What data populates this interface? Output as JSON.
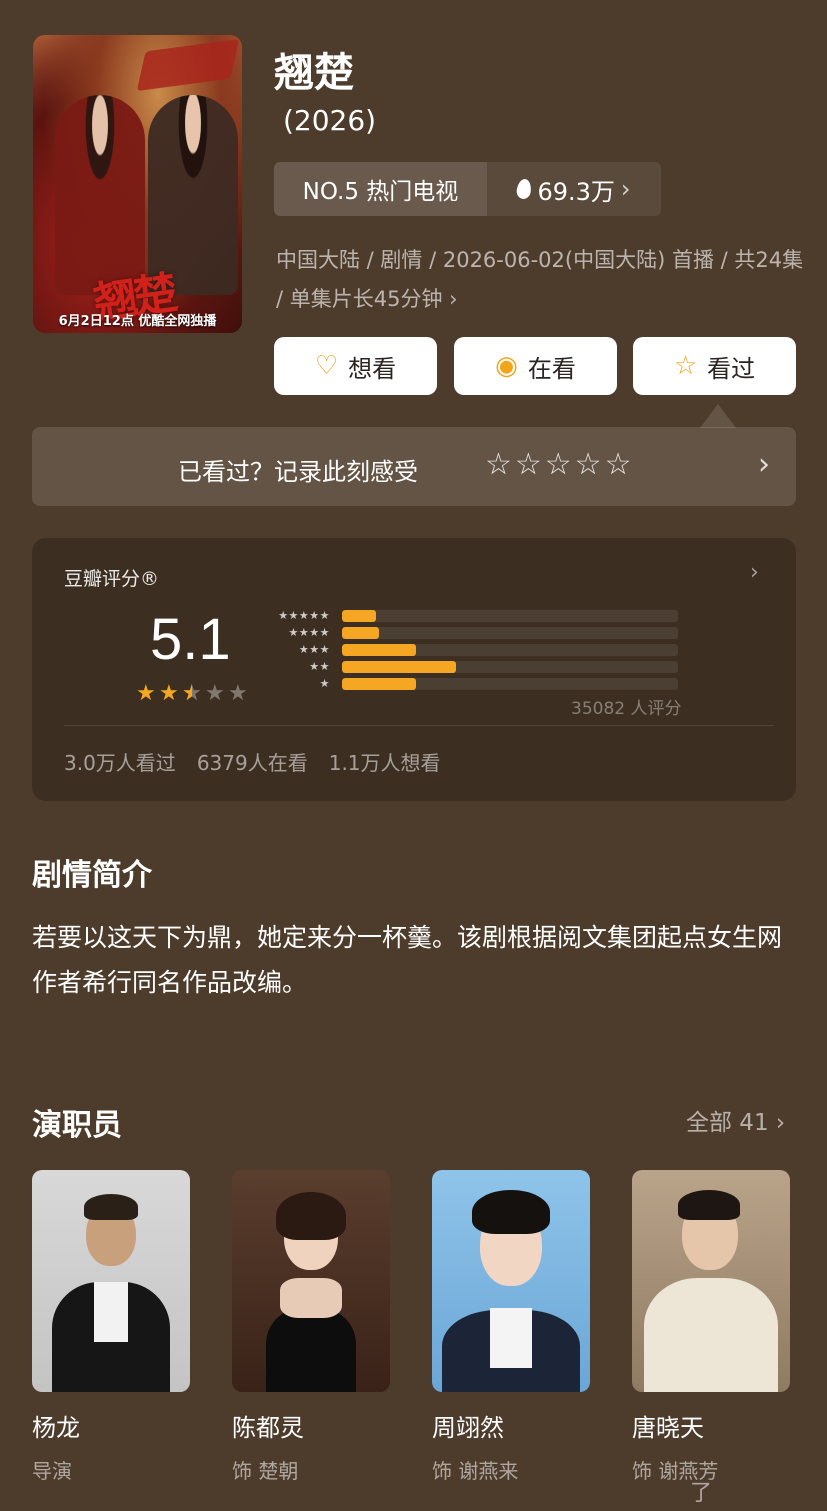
{
  "poster": {
    "calligraphy": "翘楚",
    "caption": "6月2日12点 优酷全网独播"
  },
  "header": {
    "title": "翘楚",
    "year": "(2026)",
    "rank_label": "NO.5 热门电视",
    "heat_value": "69.3万",
    "meta": "中国大陆 / 剧情 / 2026-06-02(中国大陆) 首播 / 共24集 / 单集片长45分钟 ›"
  },
  "actions": {
    "want": "想看",
    "watching": "在看",
    "watched": "看过"
  },
  "record": {
    "prompt": "已看过？记录此刻感受",
    "stars": "☆☆☆☆☆"
  },
  "rating": {
    "label": "豆瓣评分®",
    "score": "5.1",
    "score_stars": 2.5,
    "count": "35082 人评分",
    "distribution": [
      {
        "stars": "★★★★★",
        "share": 0.1
      },
      {
        "stars": "★★★★",
        "share": 0.11
      },
      {
        "stars": "★★★",
        "share": 0.22
      },
      {
        "stars": "★★",
        "share": 0.34
      },
      {
        "stars": "★",
        "share": 0.22
      }
    ],
    "accent_color": "#f5a623",
    "stats": [
      "3.0万人看过",
      "6379人在看",
      "1.1万人想看"
    ]
  },
  "plot": {
    "title": "剧情简介",
    "text": "若要以这天下为鼎，她定来分一杯羹。该剧根据阅文集团起点女生网作者希行同名作品改编。"
  },
  "cast": {
    "title": "演职员",
    "all_label": "全部 41 ›",
    "members": [
      {
        "name": "杨龙",
        "role": "导演"
      },
      {
        "name": "陈都灵",
        "role": "饰 楚朝"
      },
      {
        "name": "周翊然",
        "role": "饰 谢燕来"
      },
      {
        "name": "唐晓天",
        "role": "饰 谢燕芳"
      }
    ]
  },
  "watermark": "了"
}
